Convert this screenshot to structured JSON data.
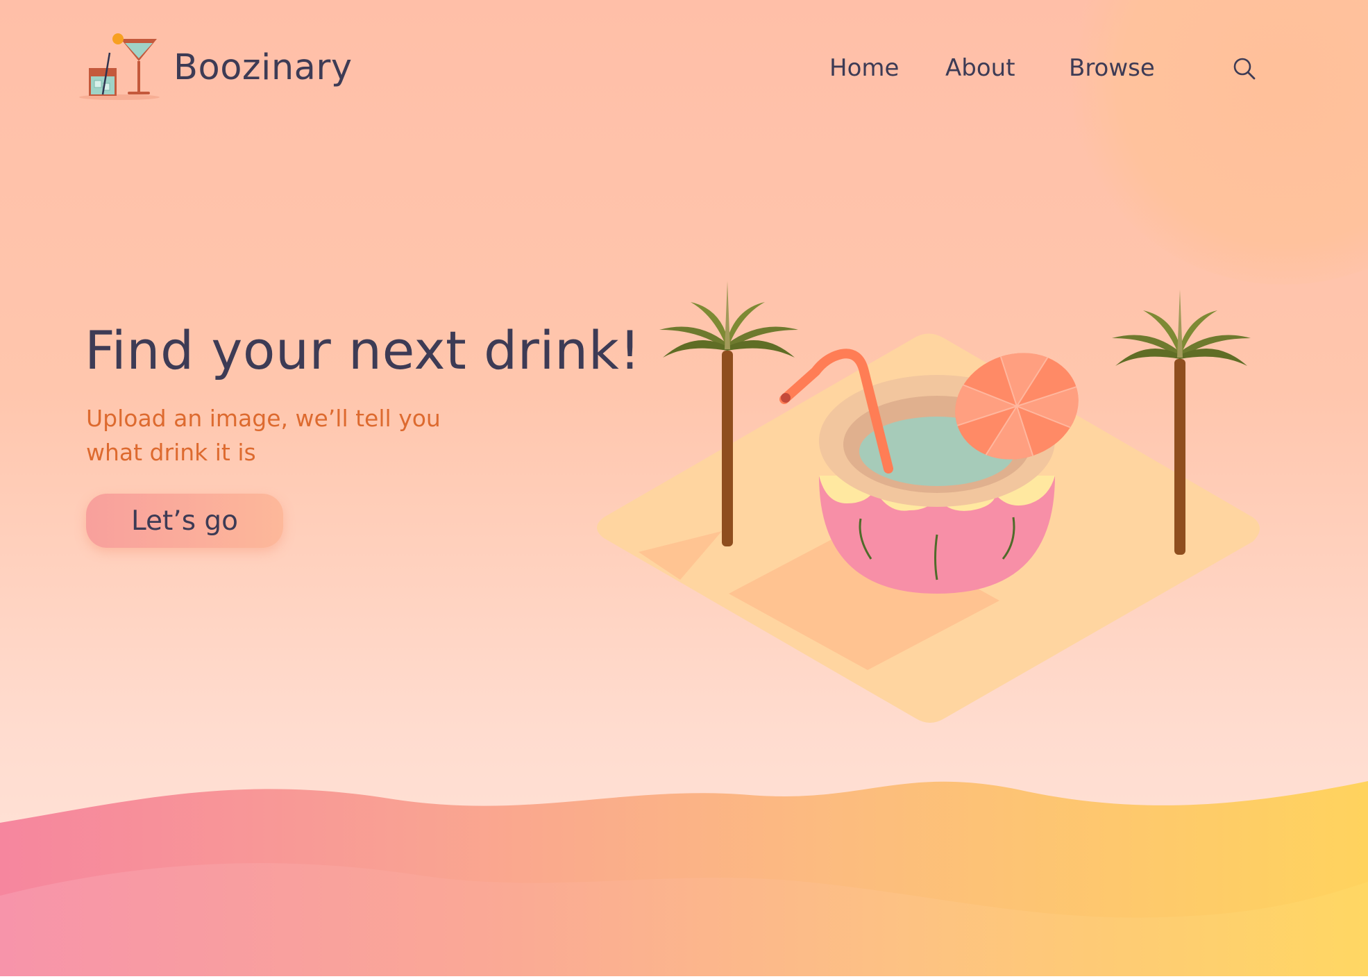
{
  "brand": {
    "name": "Boozinary"
  },
  "nav": {
    "items": [
      {
        "label": "Home"
      },
      {
        "label": "About"
      },
      {
        "label": "Browse"
      }
    ],
    "search_icon": "search-icon"
  },
  "hero": {
    "headline": "Find your next drink!",
    "subtitle": "Upload an image, we’ll tell you what drink it is",
    "cta_label": "Let’s go"
  },
  "colors": {
    "text_dark": "#3d3b55",
    "accent_orange": "#dd6a2f",
    "background_peach": "#ffc6ad",
    "button_start": "#f8a09c",
    "button_end": "#fdb89a"
  },
  "icons": [
    "cocktail-logo-icon",
    "search-icon",
    "palm-tree-icon",
    "coconut-drink-icon",
    "umbrella-icon"
  ]
}
